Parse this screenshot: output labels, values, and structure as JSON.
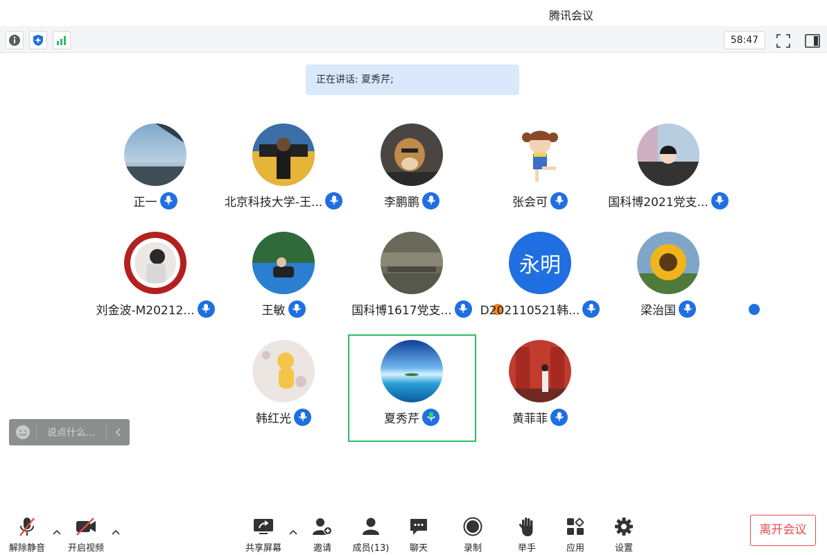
{
  "window": {
    "title": "腾讯会议"
  },
  "topbar": {
    "timer": "58:47"
  },
  "speaking": {
    "text": "正在讲话: 夏秀芹;"
  },
  "participants": [
    {
      "name": "正一"
    },
    {
      "name": "北京科技大学-王..."
    },
    {
      "name": "李鹏鹏"
    },
    {
      "name": "张会可"
    },
    {
      "name": "国科博2021党支..."
    },
    {
      "name": "刘金波-M20212..."
    },
    {
      "name": "王敏"
    },
    {
      "name": "国科博1617党支..."
    },
    {
      "name": "D202110521韩...",
      "initials": "永明"
    },
    {
      "name": "梁治国"
    },
    {
      "name": "韩红光"
    },
    {
      "name": "夏秀芹"
    },
    {
      "name": "黄菲菲"
    }
  ],
  "chat": {
    "placeholder": "说点什么..."
  },
  "toolbar": {
    "unmute": "解除静音",
    "video": "开启视频",
    "share": "共享屏幕",
    "invite": "邀请",
    "members": "成员(13)",
    "chat": "聊天",
    "record": "录制",
    "raise_hand": "举手",
    "apps": "应用",
    "settings": "设置",
    "leave": "离开会议"
  },
  "colors": {
    "accent": "#1f6fe0",
    "speaking_border": "#2dbb6a",
    "leave": "#e64b4b",
    "banner": "#d9e9fb"
  }
}
